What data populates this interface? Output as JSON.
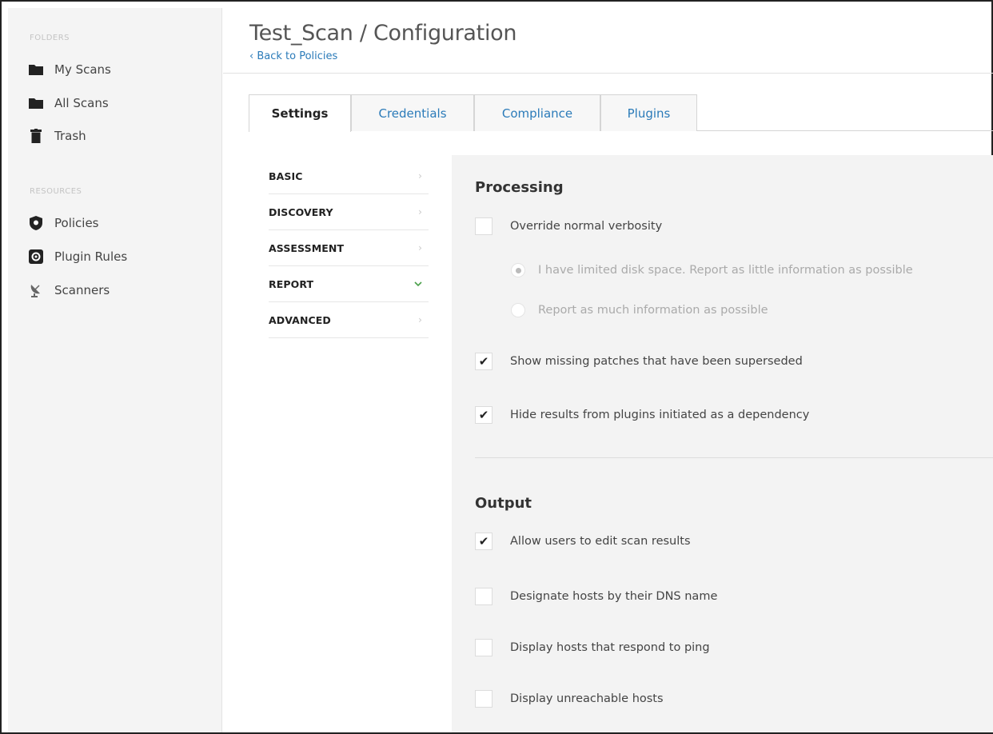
{
  "sidebar": {
    "folders_heading": "FOLDERS",
    "folders": [
      {
        "label": "My Scans",
        "icon": "folder-icon"
      },
      {
        "label": "All Scans",
        "icon": "folder-icon"
      },
      {
        "label": "Trash",
        "icon": "trash-icon"
      }
    ],
    "resources_heading": "RESOURCES",
    "resources": [
      {
        "label": "Policies",
        "icon": "shield-icon"
      },
      {
        "label": "Plugin Rules",
        "icon": "plugin-rules-icon"
      },
      {
        "label": "Scanners",
        "icon": "satellite-dish-icon"
      }
    ]
  },
  "header": {
    "title": "Test_Scan / Configuration",
    "back_link": "‹ Back to Policies"
  },
  "tabs": [
    {
      "label": "Settings",
      "active": true
    },
    {
      "label": "Credentials",
      "active": false
    },
    {
      "label": "Compliance",
      "active": false
    },
    {
      "label": "Plugins",
      "active": false
    }
  ],
  "settings_menu": [
    {
      "label": "BASIC",
      "expanded": false
    },
    {
      "label": "DISCOVERY",
      "expanded": false
    },
    {
      "label": "ASSESSMENT",
      "expanded": false
    },
    {
      "label": "REPORT",
      "expanded": true
    },
    {
      "label": "ADVANCED",
      "expanded": false
    }
  ],
  "processing": {
    "title": "Processing",
    "override_verbosity": {
      "label": "Override normal verbosity",
      "checked": false
    },
    "verbosity_options": [
      {
        "label": "I have limited disk space. Report as little information as possible",
        "selected": true
      },
      {
        "label": "Report as much information as possible",
        "selected": false
      }
    ],
    "show_missing_patches": {
      "label": "Show missing patches that have been superseded",
      "checked": true
    },
    "hide_dependency_results": {
      "label": "Hide results from plugins initiated as a dependency",
      "checked": true
    }
  },
  "output": {
    "title": "Output",
    "options": [
      {
        "label": "Allow users to edit scan results",
        "checked": true
      },
      {
        "label": "Designate hosts by their DNS name",
        "checked": false
      },
      {
        "label": "Display hosts that respond to ping",
        "checked": false
      },
      {
        "label": "Display unreachable hosts",
        "checked": false
      }
    ]
  },
  "colors": {
    "link": "#2b7bb9",
    "expanded_chevron": "#4aa04a",
    "panel_bg": "#f3f3f3",
    "sidebar_bg": "#f4f4f4"
  }
}
